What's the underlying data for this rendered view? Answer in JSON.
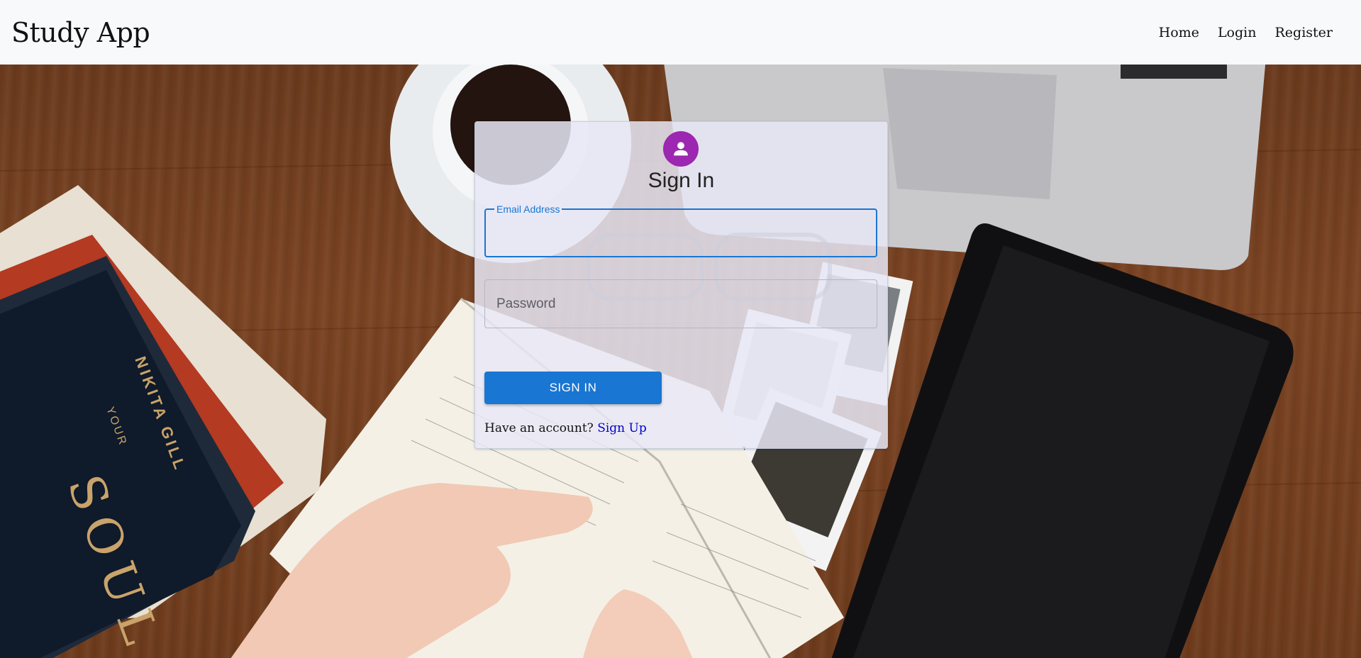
{
  "navbar": {
    "brand": "Study App",
    "links": [
      "Home",
      "Login",
      "Register"
    ]
  },
  "signin": {
    "title": "Sign In",
    "email_label": "Email Address",
    "email_value": "",
    "password_placeholder": "Password",
    "button_label": "SIGN IN",
    "account_prompt": "Have an account?",
    "signup_link": "Sign Up"
  },
  "background": {
    "books": {
      "spine_title": "SOUL",
      "spine_author": "NIKITA GILL",
      "spine_word": "YOUR"
    }
  },
  "colors": {
    "accent": "#1976d2",
    "avatar": "#9c27b0",
    "link": "#0000cc"
  },
  "icons": {
    "avatar": "person-icon"
  }
}
